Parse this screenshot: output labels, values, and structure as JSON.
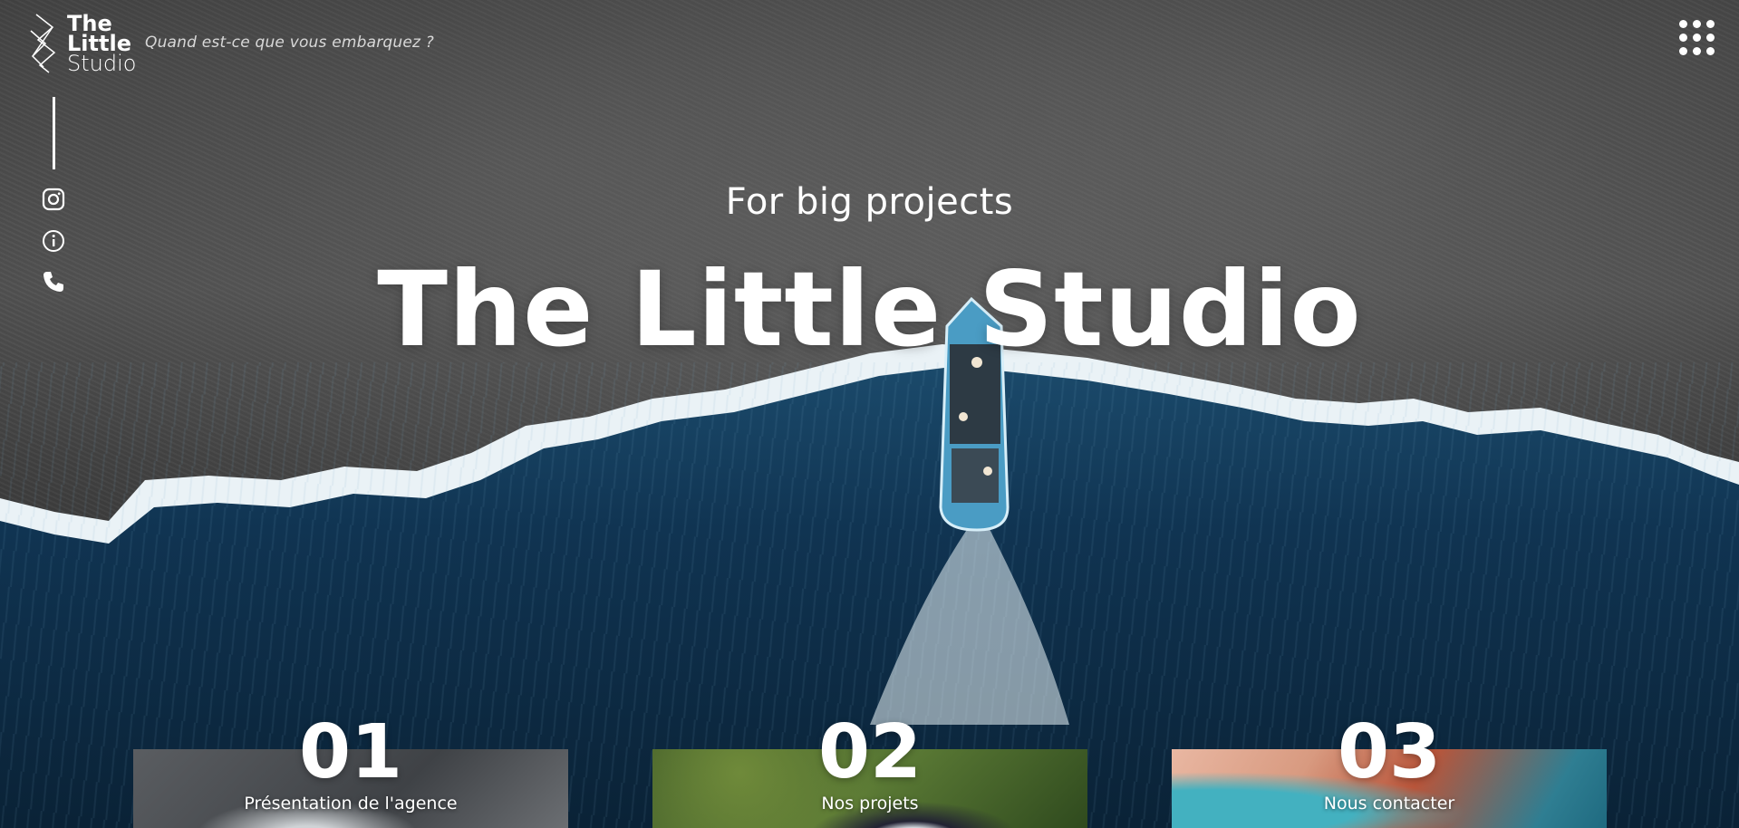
{
  "header": {
    "logo_line1": "The",
    "logo_line2": "Little",
    "logo_line3": "Studio",
    "tagline": "Quand est-ce que vous embarquez ?"
  },
  "social": {
    "icons": [
      "instagram-icon",
      "info-icon",
      "phone-icon"
    ]
  },
  "hero": {
    "subtitle": "For big projects",
    "title": "The Little Studio"
  },
  "cards": [
    {
      "number": "01",
      "label": "Présentation de l'agence"
    },
    {
      "number": "02",
      "label": "Nos projets"
    },
    {
      "number": "03",
      "label": "Nous contacter"
    }
  ],
  "colors": {
    "text": "#ffffff",
    "sand": "#3c3c3c",
    "sea": "#0e2c45",
    "foam": "#e8f0f4"
  }
}
